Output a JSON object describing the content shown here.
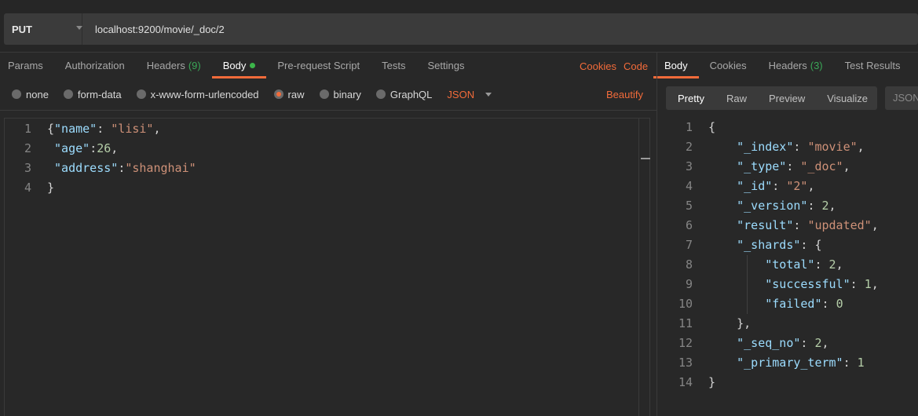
{
  "request": {
    "method": "PUT",
    "url": "localhost:9200/movie/_doc/2"
  },
  "request_tabs": [
    {
      "label": "Params"
    },
    {
      "label": "Authorization"
    },
    {
      "label": "Headers",
      "count": "(9)"
    },
    {
      "label": "Body",
      "active": true
    },
    {
      "label": "Pre-request Script"
    },
    {
      "label": "Tests"
    },
    {
      "label": "Settings"
    }
  ],
  "request_links": {
    "cookies": "Cookies",
    "code": "Code"
  },
  "body_modes": [
    {
      "label": "none"
    },
    {
      "label": "form-data"
    },
    {
      "label": "x-www-form-urlencoded"
    },
    {
      "label": "raw",
      "selected": true
    },
    {
      "label": "binary"
    },
    {
      "label": "GraphQL"
    }
  ],
  "body_format": "JSON",
  "beautify": "Beautify",
  "request_body": [
    [
      [
        "p",
        "{"
      ],
      [
        "k",
        "\"name\""
      ],
      [
        "p",
        ": "
      ],
      [
        "s",
        "\"lisi\""
      ],
      [
        "p",
        ","
      ]
    ],
    [
      [
        "p",
        " "
      ],
      [
        "k",
        "\"age\""
      ],
      [
        "p",
        ":"
      ],
      [
        "n",
        "26"
      ],
      [
        "p",
        ","
      ]
    ],
    [
      [
        "p",
        " "
      ],
      [
        "k",
        "\"address\""
      ],
      [
        "p",
        ":"
      ],
      [
        "s",
        "\"shanghai\""
      ]
    ],
    [
      [
        "p",
        "}"
      ]
    ]
  ],
  "response_tabs": [
    {
      "label": "Body",
      "active": true
    },
    {
      "label": "Cookies"
    },
    {
      "label": "Headers",
      "count": "(3)"
    },
    {
      "label": "Test Results"
    }
  ],
  "view_modes": [
    "Pretty",
    "Raw",
    "Preview",
    "Visualize"
  ],
  "response_format": "JSON",
  "response_body": [
    [
      [
        "p",
        "{"
      ]
    ],
    [
      [
        "p",
        "    "
      ],
      [
        "k",
        "\"_index\""
      ],
      [
        "p",
        ": "
      ],
      [
        "s",
        "\"movie\""
      ],
      [
        "p",
        ","
      ]
    ],
    [
      [
        "p",
        "    "
      ],
      [
        "k",
        "\"_type\""
      ],
      [
        "p",
        ": "
      ],
      [
        "s",
        "\"_doc\""
      ],
      [
        "p",
        ","
      ]
    ],
    [
      [
        "p",
        "    "
      ],
      [
        "k",
        "\"_id\""
      ],
      [
        "p",
        ": "
      ],
      [
        "s",
        "\"2\""
      ],
      [
        "p",
        ","
      ]
    ],
    [
      [
        "p",
        "    "
      ],
      [
        "k",
        "\"_version\""
      ],
      [
        "p",
        ": "
      ],
      [
        "n",
        "2"
      ],
      [
        "p",
        ","
      ]
    ],
    [
      [
        "p",
        "    "
      ],
      [
        "k",
        "\"result\""
      ],
      [
        "p",
        ": "
      ],
      [
        "s",
        "\"updated\""
      ],
      [
        "p",
        ","
      ]
    ],
    [
      [
        "p",
        "    "
      ],
      [
        "k",
        "\"_shards\""
      ],
      [
        "p",
        ": {"
      ]
    ],
    [
      [
        "p",
        "        "
      ],
      [
        "k",
        "\"total\""
      ],
      [
        "p",
        ": "
      ],
      [
        "n",
        "2"
      ],
      [
        "p",
        ","
      ]
    ],
    [
      [
        "p",
        "        "
      ],
      [
        "k",
        "\"successful\""
      ],
      [
        "p",
        ": "
      ],
      [
        "n",
        "1"
      ],
      [
        "p",
        ","
      ]
    ],
    [
      [
        "p",
        "        "
      ],
      [
        "k",
        "\"failed\""
      ],
      [
        "p",
        ": "
      ],
      [
        "n",
        "0"
      ]
    ],
    [
      [
        "p",
        "    },"
      ]
    ],
    [
      [
        "p",
        "    "
      ],
      [
        "k",
        "\"_seq_no\""
      ],
      [
        "p",
        ": "
      ],
      [
        "n",
        "2"
      ],
      [
        "p",
        ","
      ]
    ],
    [
      [
        "p",
        "    "
      ],
      [
        "k",
        "\"_primary_term\""
      ],
      [
        "p",
        ": "
      ],
      [
        "n",
        "1"
      ]
    ],
    [
      [
        "p",
        "}"
      ]
    ]
  ],
  "colors": {
    "accent": "#f26b3a",
    "key": "#9cdcfe",
    "string": "#ce9178",
    "number": "#b5cea8",
    "count": "#3aa757"
  }
}
